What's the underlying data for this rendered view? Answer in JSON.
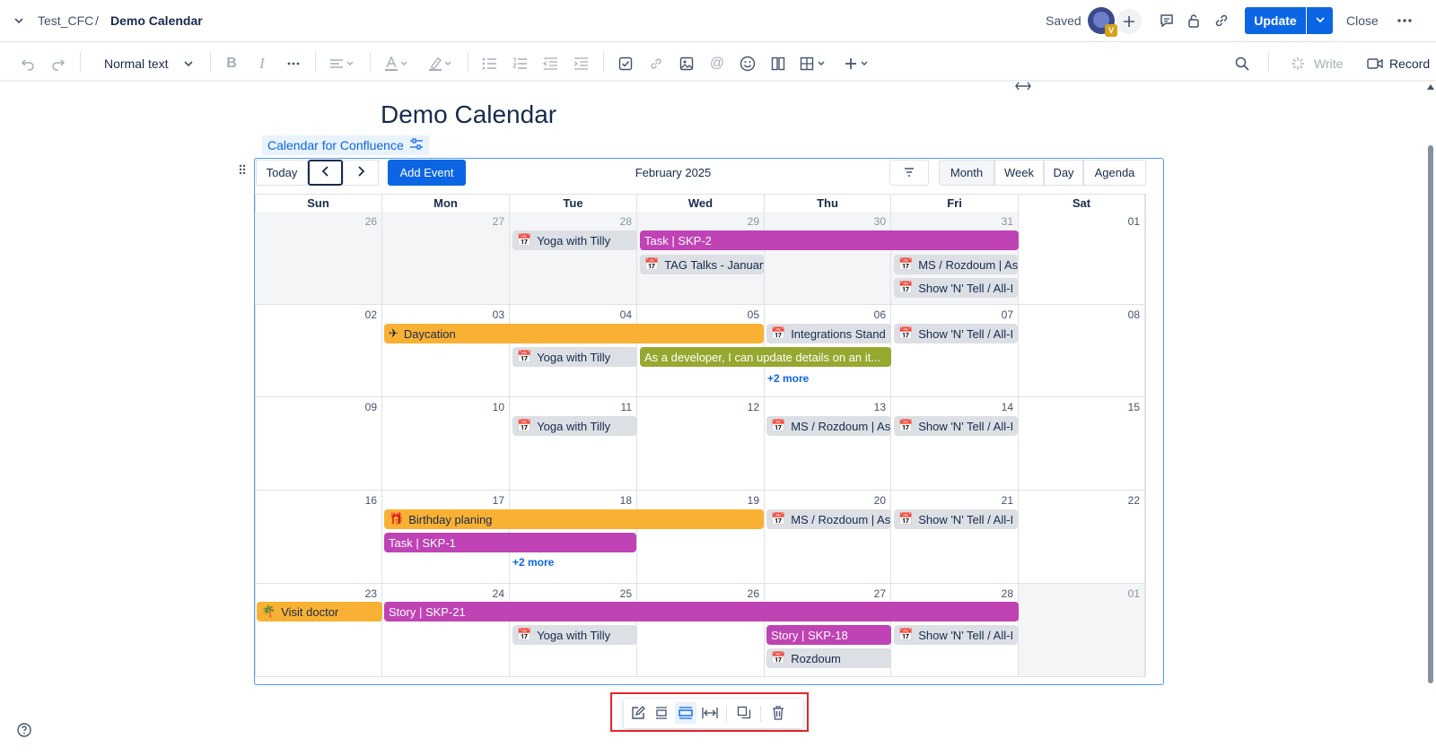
{
  "topbar": {
    "space": "Test_CFC",
    "separator": "/",
    "page": "Demo Calendar",
    "saved": "Saved",
    "avatar_badge": "V",
    "update": "Update",
    "close": "Close"
  },
  "toolbar": {
    "text_style": "Normal text",
    "write": "Write",
    "record": "Record"
  },
  "page": {
    "title": "Demo Calendar",
    "macro_label": "Calendar for Confluence"
  },
  "calendar": {
    "today": "Today",
    "add_event": "Add Event",
    "month_label": "February 2025",
    "views": [
      "Month",
      "Week",
      "Day",
      "Agenda"
    ],
    "active_view": "Month",
    "weekdays": [
      "Sun",
      "Mon",
      "Tue",
      "Wed",
      "Thu",
      "Fri",
      "Sat"
    ],
    "weeks": [
      [
        "26",
        "27",
        "28",
        "29",
        "30",
        "31",
        "01"
      ],
      [
        "02",
        "03",
        "04",
        "05",
        "06",
        "07",
        "08"
      ],
      [
        "09",
        "10",
        "11",
        "12",
        "13",
        "14",
        "15"
      ],
      [
        "16",
        "17",
        "18",
        "19",
        "20",
        "21",
        "22"
      ],
      [
        "23",
        "24",
        "25",
        "26",
        "27",
        "28",
        "01"
      ]
    ],
    "events": {
      "yoga": "Yoga with Tilly",
      "task_skp2": "Task | SKP-2",
      "tag_talks": "TAG Talks - January",
      "ms_rozdoum": "MS / Rozdoum | As",
      "show_tell": "Show 'N' Tell / All-I",
      "daycation": "Daycation",
      "integrations": "Integrations Stand",
      "developer_story": "As a developer, I can update details on an it...",
      "birthday": "Birthday planing",
      "task_skp1": "Task | SKP-1",
      "visit_doctor": "Visit doctor",
      "story_skp21": "Story | SKP-21",
      "story_skp18": "Story | SKP-18",
      "rozdoum": "Rozdoum"
    },
    "more_label": "+2 more"
  },
  "colors": {
    "accent": "#0c66e4",
    "event_purple": "#bf43b5",
    "event_orange": "#f9b133",
    "event_olive": "#97a831",
    "event_gray": "#dcdfe4",
    "highlight_box": "#e5252a"
  }
}
